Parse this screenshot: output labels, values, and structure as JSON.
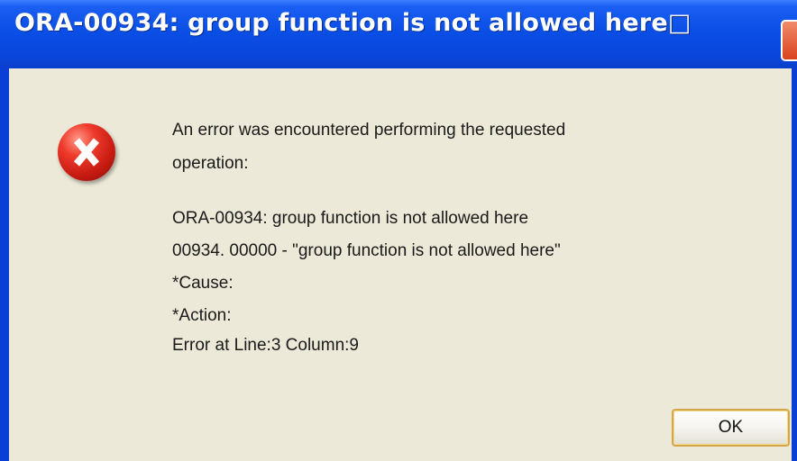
{
  "window": {
    "title": "ORA-00934: group function is not allowed here□"
  },
  "dialog": {
    "icon": "error-icon",
    "message_lines": [
      "An error was encountered performing the requested",
      "operation:",
      "ORA-00934: group function is not allowed here",
      "00934. 00000 -  \"group function is not allowed here\"",
      "*Cause:",
      "*Action:",
      "Error at Line:3 Column:9"
    ],
    "ok_label": "OK"
  },
  "colors": {
    "titlebar": "#0a4fe6",
    "client_background": "#ece9d8",
    "error_icon": "#d9261b",
    "ok_border": "#d4a84a"
  }
}
